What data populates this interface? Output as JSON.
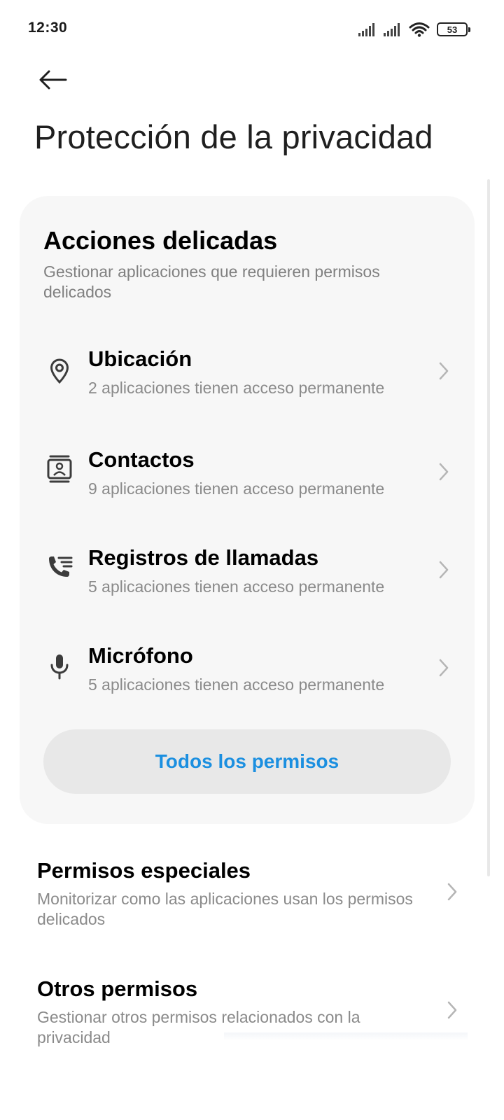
{
  "status_bar": {
    "time": "12:30",
    "battery": "53"
  },
  "header": {
    "title": "Protección de la privacidad"
  },
  "sensitive_actions": {
    "title": "Acciones delicadas",
    "subtitle": "Gestionar aplicaciones que requieren permisos delicados",
    "items": [
      {
        "title": "Ubicación",
        "description": "2 aplicaciones tienen acceso permanente",
        "icon": "location-pin-icon"
      },
      {
        "title": "Contactos",
        "description": "9 aplicaciones tienen acceso permanente",
        "icon": "contacts-icon"
      },
      {
        "title": "Registros de llamadas",
        "description": "5 aplicaciones tienen acceso permanente",
        "icon": "call-log-icon"
      },
      {
        "title": "Micrófono",
        "description": "5 aplicaciones tienen acceso permanente",
        "icon": "microphone-icon"
      }
    ],
    "all_permissions_label": "Todos los permisos"
  },
  "other_sections": [
    {
      "title": "Permisos especiales",
      "description": "Monitorizar como las aplicaciones usan los permisos delicados"
    },
    {
      "title": "Otros permisos",
      "description": "Gestionar otros permisos relacionados con la privacidad"
    }
  ],
  "colors": {
    "accent": "#1b8fe0",
    "card_background": "#f7f7f7",
    "secondary_text": "#8a8a8a"
  }
}
